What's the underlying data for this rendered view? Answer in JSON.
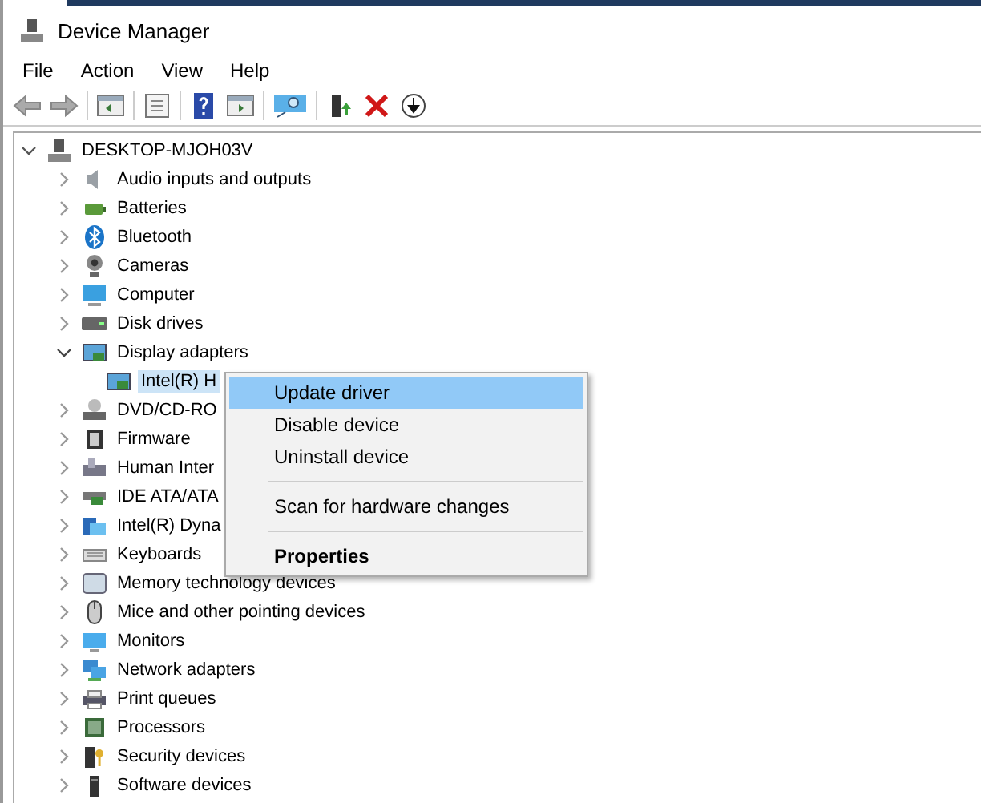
{
  "window": {
    "title": "Device Manager"
  },
  "menu_bar": [
    "File",
    "Action",
    "View",
    "Help"
  ],
  "tree": {
    "label": "DESKTOP-MJOH03V",
    "expanded": true,
    "selected": false,
    "children": [
      {
        "label": "Audio inputs and outputs",
        "expanded": false,
        "selected": false
      },
      {
        "label": "Batteries",
        "expanded": false,
        "selected": false
      },
      {
        "label": "Bluetooth",
        "expanded": false,
        "selected": false
      },
      {
        "label": "Cameras",
        "expanded": false,
        "selected": false
      },
      {
        "label": "Computer",
        "expanded": false,
        "selected": false
      },
      {
        "label": "Disk drives",
        "expanded": false,
        "selected": false
      },
      {
        "label": "Display adapters",
        "expanded": true,
        "selected": false,
        "children": [
          {
            "label": "Intel(R) H",
            "selected": true
          }
        ]
      },
      {
        "label": "DVD/CD-RO",
        "expanded": false,
        "selected": false
      },
      {
        "label": "Firmware",
        "expanded": false,
        "selected": false
      },
      {
        "label": "Human Inter",
        "expanded": false,
        "selected": false
      },
      {
        "label": "IDE ATA/ATA",
        "expanded": false,
        "selected": false
      },
      {
        "label": "Intel(R) Dyna",
        "expanded": false,
        "selected": false
      },
      {
        "label": "Keyboards",
        "expanded": false,
        "selected": false
      },
      {
        "label": "Memory technology devices",
        "expanded": false,
        "selected": false
      },
      {
        "label": "Mice and other pointing devices",
        "expanded": false,
        "selected": false
      },
      {
        "label": "Monitors",
        "expanded": false,
        "selected": false
      },
      {
        "label": "Network adapters",
        "expanded": false,
        "selected": false
      },
      {
        "label": "Print queues",
        "expanded": false,
        "selected": false
      },
      {
        "label": "Processors",
        "expanded": false,
        "selected": false
      },
      {
        "label": "Security devices",
        "expanded": false,
        "selected": false
      },
      {
        "label": "Software devices",
        "expanded": false,
        "selected": false
      }
    ]
  },
  "context_menu": [
    {
      "kind": "item",
      "label": "Update driver",
      "selected": true,
      "default": false
    },
    {
      "kind": "item",
      "label": "Disable device",
      "selected": false,
      "default": false
    },
    {
      "kind": "item",
      "label": "Uninstall device",
      "selected": false,
      "default": false
    },
    {
      "kind": "separator"
    },
    {
      "kind": "item",
      "label": "Scan for hardware changes",
      "selected": false,
      "default": false
    },
    {
      "kind": "separator"
    },
    {
      "kind": "item",
      "label": "Properties",
      "selected": false,
      "default": true
    }
  ]
}
